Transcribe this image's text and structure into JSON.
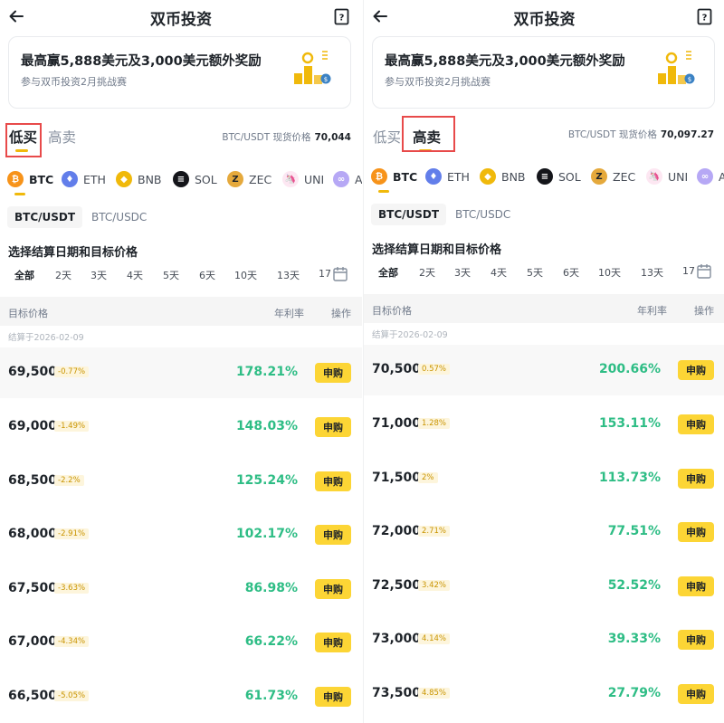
{
  "colors": {
    "accent": "#fcd535",
    "brand": "#f0b90b",
    "positive": "#2ebd85",
    "highlight": "#e84a4a"
  },
  "screens": [
    {
      "header": {
        "title": "双币投资",
        "back_icon": "arrow-left-icon",
        "help_icon": "help-book-icon"
      },
      "banner": {
        "title": "最高赢5,888美元及3,000美元额外奖励",
        "subtitle": "参与双币投资2月挑战赛",
        "icon": "trophy-coins-icon"
      },
      "tabs": {
        "buy_low": "低买",
        "sell_high": "高卖",
        "selected": "低买"
      },
      "spot": {
        "label": "BTC/USDT 现货价格",
        "value": "70,044"
      },
      "coins": [
        "BTC",
        "ETH",
        "BNB",
        "SOL",
        "ZEC",
        "UNI",
        "A"
      ],
      "selected_coin": "BTC",
      "pairs": [
        "BTC/USDT",
        "BTC/USDC"
      ],
      "selected_pair": "BTC/USDT",
      "section_title": "选择结算日期和目标价格",
      "days": [
        "全部",
        "2天",
        "3天",
        "4天",
        "5天",
        "6天",
        "10天",
        "13天",
        "17"
      ],
      "table": {
        "col_target": "目标价格",
        "col_apr": "年利率",
        "col_action": "操作",
        "settle_label": "结算于2026-02-09",
        "rows": [
          {
            "price": "69,500",
            "pct": "-0.77%",
            "apr": "178.21%",
            "action": "申购"
          },
          {
            "price": "69,000",
            "pct": "-1.49%",
            "apr": "148.03%",
            "action": "申购"
          },
          {
            "price": "68,500",
            "pct": "-2.2%",
            "apr": "125.24%",
            "action": "申购"
          },
          {
            "price": "68,000",
            "pct": "-2.91%",
            "apr": "102.17%",
            "action": "申购"
          },
          {
            "price": "67,500",
            "pct": "-3.63%",
            "apr": "86.98%",
            "action": "申购"
          },
          {
            "price": "67,000",
            "pct": "-4.34%",
            "apr": "66.22%",
            "action": "申购"
          },
          {
            "price": "66,500",
            "pct": "-5.05%",
            "apr": "61.73%",
            "action": "申购"
          }
        ]
      }
    },
    {
      "header": {
        "title": "双币投资",
        "back_icon": "arrow-left-icon",
        "help_icon": "help-book-icon"
      },
      "banner": {
        "title": "最高赢5,888美元及3,000美元额外奖励",
        "subtitle": "参与双币投资2月挑战赛",
        "icon": "trophy-coins-icon"
      },
      "tabs": {
        "buy_low": "低买",
        "sell_high": "高卖",
        "selected": "高卖"
      },
      "spot": {
        "label": "BTC/USDT 现货价格",
        "value": "70,097.27"
      },
      "coins": [
        "BTC",
        "ETH",
        "BNB",
        "SOL",
        "ZEC",
        "UNI",
        "A"
      ],
      "selected_coin": "BTC",
      "pairs": [
        "BTC/USDT",
        "BTC/USDC"
      ],
      "selected_pair": "BTC/USDT",
      "section_title": "选择结算日期和目标价格",
      "days": [
        "全部",
        "2天",
        "3天",
        "4天",
        "5天",
        "6天",
        "10天",
        "13天",
        "17"
      ],
      "table": {
        "col_target": "目标价格",
        "col_apr": "年利率",
        "col_action": "操作",
        "settle_label": "结算于2026-02-09",
        "rows": [
          {
            "price": "70,500",
            "pct": "0.57%",
            "apr": "200.66%",
            "action": "申购"
          },
          {
            "price": "71,000",
            "pct": "1.28%",
            "apr": "153.11%",
            "action": "申购"
          },
          {
            "price": "71,500",
            "pct": "2%",
            "apr": "113.73%",
            "action": "申购"
          },
          {
            "price": "72,000",
            "pct": "2.71%",
            "apr": "77.51%",
            "action": "申购"
          },
          {
            "price": "72,500",
            "pct": "3.42%",
            "apr": "52.52%",
            "action": "申购"
          },
          {
            "price": "73,000",
            "pct": "4.14%",
            "apr": "39.33%",
            "action": "申购"
          },
          {
            "price": "73,500",
            "pct": "4.85%",
            "apr": "27.79%",
            "action": "申购"
          }
        ]
      }
    }
  ]
}
